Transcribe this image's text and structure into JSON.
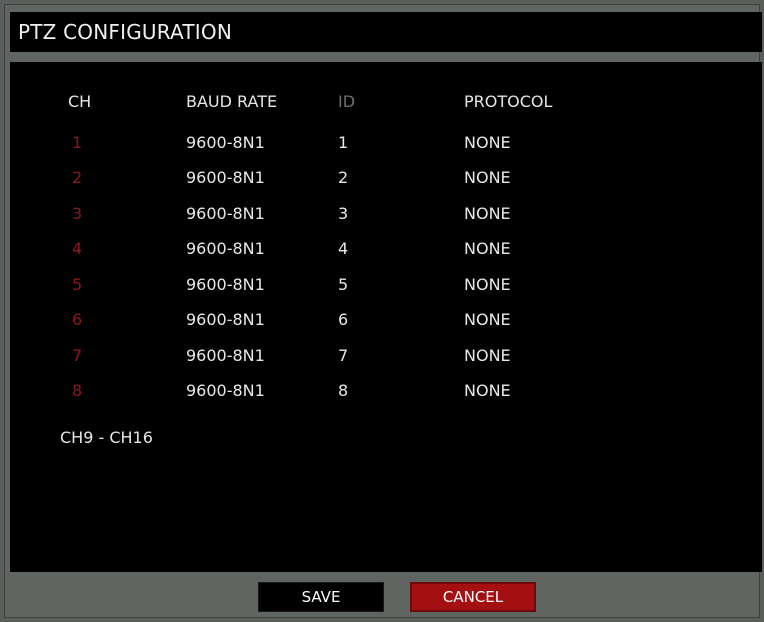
{
  "title": "PTZ CONFIGURATION",
  "columns": {
    "ch": "CH",
    "baud": "BAUD RATE",
    "id": "ID",
    "protocol": "PROTOCOL"
  },
  "rows": [
    {
      "ch": "1",
      "baud": "9600-8N1",
      "id": "1",
      "protocol": "NONE"
    },
    {
      "ch": "2",
      "baud": "9600-8N1",
      "id": "2",
      "protocol": "NONE"
    },
    {
      "ch": "3",
      "baud": "9600-8N1",
      "id": "3",
      "protocol": "NONE"
    },
    {
      "ch": "4",
      "baud": "9600-8N1",
      "id": "4",
      "protocol": "NONE"
    },
    {
      "ch": "5",
      "baud": "9600-8N1",
      "id": "5",
      "protocol": "NONE"
    },
    {
      "ch": "6",
      "baud": "9600-8N1",
      "id": "6",
      "protocol": "NONE"
    },
    {
      "ch": "7",
      "baud": "9600-8N1",
      "id": "7",
      "protocol": "NONE"
    },
    {
      "ch": "8",
      "baud": "9600-8N1",
      "id": "8",
      "protocol": "NONE"
    }
  ],
  "next_page_link": "CH9 - CH16",
  "buttons": {
    "save": "SAVE",
    "cancel": "CANCEL"
  },
  "colors": {
    "channel_number": "#8a1a1a",
    "cancel_button": "#a40f12",
    "frame": "#606561",
    "panel": "#000000"
  }
}
